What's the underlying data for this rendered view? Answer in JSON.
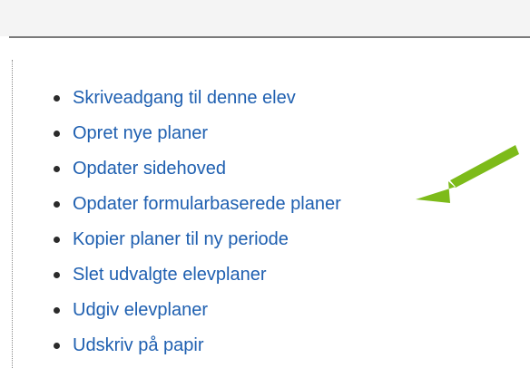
{
  "menu": {
    "items": [
      {
        "label": "Skriveadgang til denne elev"
      },
      {
        "label": "Opret nye planer"
      },
      {
        "label": "Opdater sidehoved"
      },
      {
        "label": "Opdater formularbaserede planer"
      },
      {
        "label": "Kopier planer til ny periode"
      },
      {
        "label": "Slet udvalgte elevplaner"
      },
      {
        "label": "Udgiv elevplaner"
      },
      {
        "label": "Udskriv på papir"
      }
    ]
  },
  "annotation": {
    "icon": "arrow-icon",
    "color": "#7dbb1a",
    "points_to": "Opdater formularbaserede planer"
  }
}
